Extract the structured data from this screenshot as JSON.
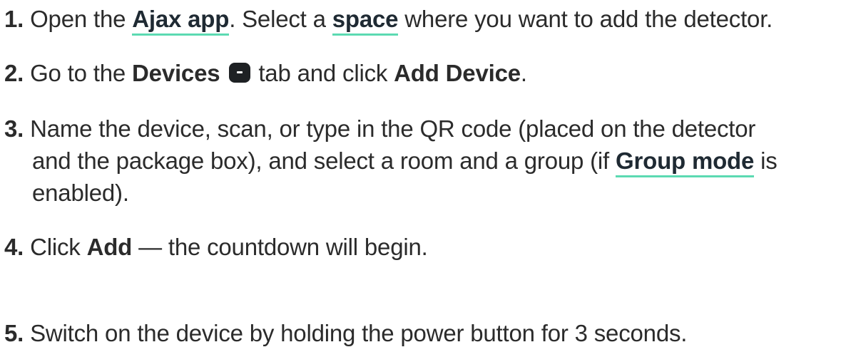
{
  "steps": [
    {
      "number": "1.",
      "t1": "Open the ",
      "link1": "Ajax app",
      "t2": ". Select a ",
      "link2": "space",
      "t3": " where you want to add the detector."
    },
    {
      "number": "2.",
      "t1": "Go to the ",
      "b1": "Devices",
      "icon": "devices-tab-icon",
      "t2": " tab and click ",
      "b2": "Add Device",
      "t3": "."
    },
    {
      "number": "3.",
      "line1": "Name the device, scan, or type in the QR code (placed on the detector",
      "line2_pre": "and the package box), and select a room and a group (if ",
      "link": "Group mode",
      "line2_post": " is",
      "line3": "enabled)."
    },
    {
      "number": "4.",
      "t1": "Click ",
      "b1": "Add",
      "t2": " — the countdown will begin."
    },
    {
      "number": "5.",
      "t1": "Switch on the device by holding the power button for 3 seconds."
    }
  ],
  "colors": {
    "text": "#2b2b2b",
    "link_underline": "#5cdab2",
    "icon_bg": "#1e2124"
  }
}
